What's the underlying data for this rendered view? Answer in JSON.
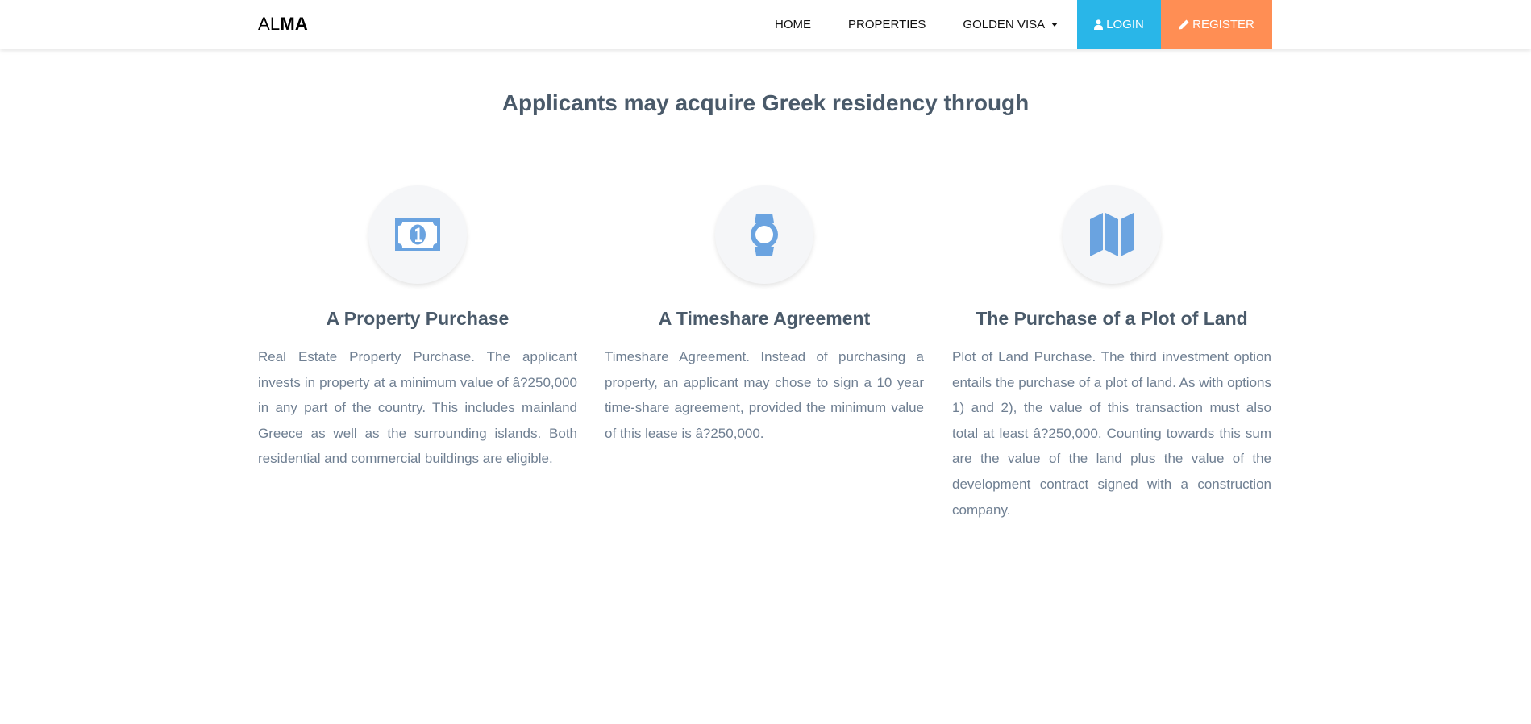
{
  "navbar": {
    "brand_prefix": "AL",
    "brand_suffix": "MA",
    "links": {
      "home": "HOME",
      "properties": "PROPERTIES",
      "golden_visa": "GOLDEN VISA"
    },
    "login_label": "LOGIN",
    "register_label": "REGISTER",
    "login_icon": "user-icon",
    "register_icon": "pencil-icon"
  },
  "main": {
    "heading": "Applicants may acquire Greek residency through",
    "features": [
      {
        "icon": "money-bill-icon",
        "title": "A Property Purchase",
        "description": "Real Estate Property Purchase. The applicant invests in property at a minimum value of â?250,000 in any part of the country. This includes mainland Greece as well as the surrounding islands. Both residential and commercial buildings are eligible."
      },
      {
        "icon": "watch-icon",
        "title": "A Timeshare Agreement",
        "description": "Timeshare Agreement. Instead of purchasing a property, an applicant may chose to sign a 10 year time-share agreement, provided the minimum value of this lease is â?250,000."
      },
      {
        "icon": "map-icon",
        "title": "The Purchase of a Plot of Land",
        "description": "Plot of Land Purchase. The third investment option entails the purchase of a plot of land. As with options 1) and 2), the value of this transaction must also total at least â?250,000. Counting towards this sum are the value of the land plus the value of the development contract signed with a construction company."
      }
    ]
  },
  "colors": {
    "login_bg": "#29b6e8",
    "register_bg": "#ff8e54",
    "icon": "#6aa3e0",
    "heading": "#4a5a6a",
    "body_text": "#6f7f92"
  }
}
